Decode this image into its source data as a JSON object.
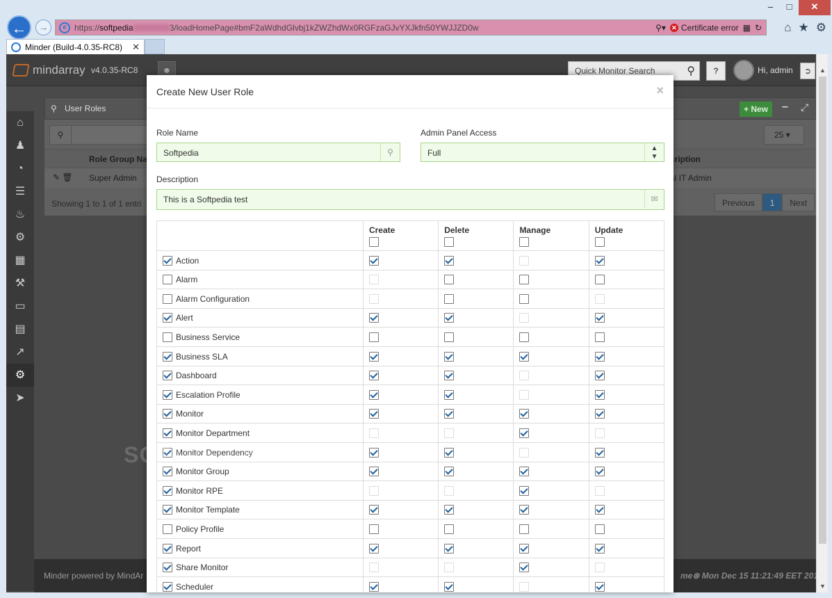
{
  "browser": {
    "url_prefix": "https://",
    "url_host": "softpedia",
    "url_rest": "3/loadHomePage#bmF2aWdhdGlvbj1kZWZhdWx0RGFzaGJvYXJkfn50YWJJZD0w",
    "cert_error": "Certificate error",
    "tab_title": "Minder (Build-4.0.35-RC8)"
  },
  "app": {
    "logo_text": "mindarray",
    "version": "v4.0.35-RC8",
    "quick_search_placeholder": "Quick Monitor Search",
    "help_label": "?",
    "greeting": "Hi, admin",
    "footer_left": "Minder powered by MindAr",
    "footer_right": "me⊗ Mon Dec 15 11:21:49 EET 201"
  },
  "panel": {
    "title": "User Roles",
    "new_button": "New",
    "page_size": "25",
    "col_role_group": "Role Group Nam",
    "col_description": "cription",
    "row_role": "Super Admin",
    "row_description": "al IT Admin",
    "showing": "Showing 1 to 1 of 1 entri",
    "pager_prev": "Previous",
    "pager_current": "1",
    "pager_next": "Next"
  },
  "watermark": "SOFTPEDIA",
  "modal": {
    "title": "Create New User Role",
    "close": "×",
    "role_name_label": "Role Name",
    "role_name_value": "Softpedia",
    "admin_access_label": "Admin Panel Access",
    "admin_access_value": "Full",
    "description_label": "Description",
    "description_value": "This is a Softpedia test",
    "columns": [
      "Create",
      "Delete",
      "Manage",
      "Update"
    ],
    "permissions": [
      {
        "name": "Action",
        "on": true,
        "c": "on",
        "d": "on",
        "m": "dis",
        "u": "on"
      },
      {
        "name": "Alarm",
        "on": false,
        "c": "dis",
        "d": "off",
        "m": "off",
        "u": "off"
      },
      {
        "name": "Alarm Configuration",
        "on": false,
        "c": "dis",
        "d": "off",
        "m": "off",
        "u": "dis"
      },
      {
        "name": "Alert",
        "on": true,
        "c": "on",
        "d": "on",
        "m": "dis",
        "u": "on"
      },
      {
        "name": "Business Service",
        "on": false,
        "c": "off",
        "d": "off",
        "m": "off",
        "u": "off"
      },
      {
        "name": "Business SLA",
        "on": true,
        "c": "on",
        "d": "on",
        "m": "on",
        "u": "on"
      },
      {
        "name": "Dashboard",
        "on": true,
        "c": "on",
        "d": "on",
        "m": "dis",
        "u": "on"
      },
      {
        "name": "Escalation Profile",
        "on": true,
        "c": "on",
        "d": "on",
        "m": "dis",
        "u": "on"
      },
      {
        "name": "Monitor",
        "on": true,
        "c": "on",
        "d": "on",
        "m": "on",
        "u": "on"
      },
      {
        "name": "Monitor Department",
        "on": true,
        "c": "dis",
        "d": "dis",
        "m": "on",
        "u": "dis"
      },
      {
        "name": "Monitor Dependency",
        "on": true,
        "c": "on",
        "d": "on",
        "m": "dis",
        "u": "on"
      },
      {
        "name": "Monitor Group",
        "on": true,
        "c": "on",
        "d": "on",
        "m": "on",
        "u": "on"
      },
      {
        "name": "Monitor RPE",
        "on": true,
        "c": "dis",
        "d": "dis",
        "m": "on",
        "u": "dis"
      },
      {
        "name": "Monitor Template",
        "on": true,
        "c": "on",
        "d": "on",
        "m": "on",
        "u": "on"
      },
      {
        "name": "Policy Profile",
        "on": false,
        "c": "off",
        "d": "off",
        "m": "off",
        "u": "off"
      },
      {
        "name": "Report",
        "on": true,
        "c": "on",
        "d": "on",
        "m": "on",
        "u": "on"
      },
      {
        "name": "Share Monitor",
        "on": true,
        "c": "dis",
        "d": "dis",
        "m": "on",
        "u": "dis"
      },
      {
        "name": "Scheduler",
        "on": true,
        "c": "on",
        "d": "on",
        "m": "dis",
        "u": "on"
      }
    ]
  }
}
